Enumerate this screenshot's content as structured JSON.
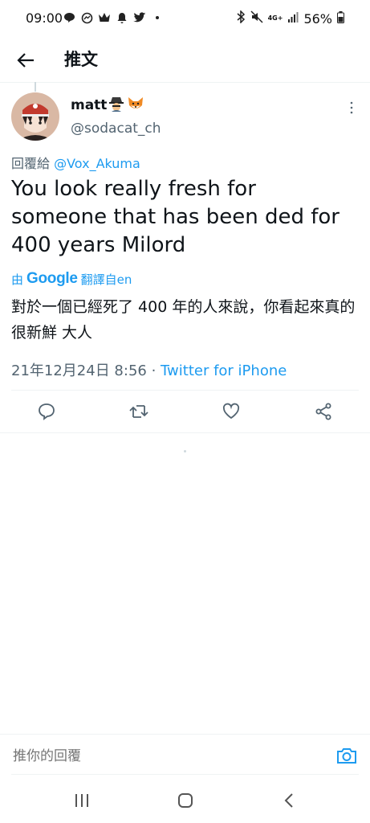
{
  "status_bar": {
    "time": "09:00",
    "signal_label": "4G+",
    "battery": "56%"
  },
  "header": {
    "title": "推文"
  },
  "tweet": {
    "display_name": "matt",
    "emojis": [
      "detective-emoji",
      "fox-emoji"
    ],
    "handle": "@sodacat_ch",
    "reply_prefix": "回覆給 ",
    "reply_to": "@Vox_Akuma",
    "text": "You look really fresh for someone that has been ded for 400 years Milord",
    "translate_by": "由",
    "translate_provider": "Google",
    "translate_label": "翻譯自en",
    "translated_text": "對於一個已經死了 400 年的人來說，你看起來真的很新鮮 大人",
    "timestamp": "21年12月24日 8:56",
    "separator": " · ",
    "source": "Twitter for iPhone"
  },
  "actions": [
    "reply-icon",
    "retweet-icon",
    "like-icon",
    "share-icon"
  ],
  "composer": {
    "placeholder": "推你的回覆"
  },
  "colors": {
    "accent": "#1d9bf0",
    "secondary_text": "#536471",
    "divider": "#eff3f4"
  }
}
